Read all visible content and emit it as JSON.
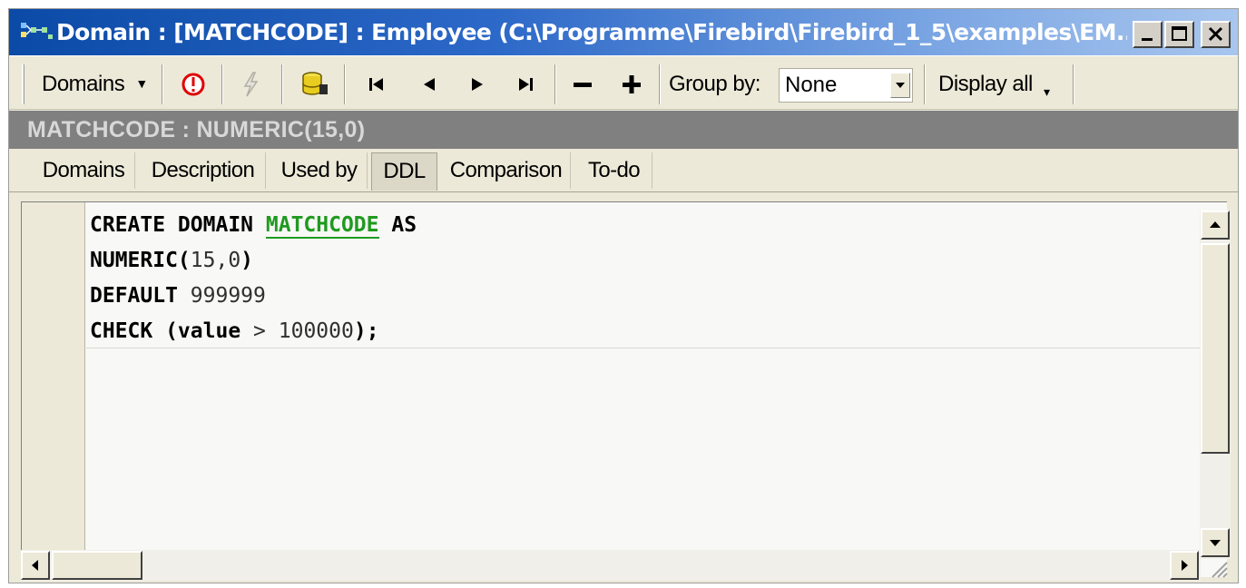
{
  "window": {
    "title": "Domain : [MATCHCODE] : Employee (C:\\Programme\\Firebird\\Firebird_1_5\\examples\\EM..."
  },
  "toolbar": {
    "domains_label": "Domains",
    "group_by_label": "Group by:",
    "group_by_value": "None",
    "display_all_label": "Display all"
  },
  "header": {
    "object_label": "MATCHCODE : NUMERIC(15,0)"
  },
  "tabs": [
    {
      "label": "Domains",
      "active": false
    },
    {
      "label": "Description",
      "active": false
    },
    {
      "label": "Used by",
      "active": false
    },
    {
      "label": "DDL",
      "active": true
    },
    {
      "label": "Comparison",
      "active": false
    },
    {
      "label": "To-do",
      "active": false
    }
  ],
  "code": {
    "line1_kw1": "CREATE DOMAIN",
    "line1_ident": "MATCHCODE",
    "line1_kw2": "AS",
    "line2_kw": "NUMERIC(",
    "line2_val": "15,0",
    "line2_close": ")",
    "line3_kw": "DEFAULT",
    "line3_val": "999999",
    "line4_kw": "CHECK (value",
    "line4_op": ">",
    "line4_val": "100000",
    "line4_end": ");"
  },
  "icons": {
    "app": "tree-icon",
    "stop": "stop-icon",
    "lightning": "lightning-icon",
    "database": "database-icon",
    "first": "first-record-icon",
    "prev": "prev-record-icon",
    "next": "next-record-icon",
    "last": "last-record-icon",
    "delete": "delete-icon",
    "add": "add-icon"
  },
  "colors": {
    "title_bar": "#0b4aa7",
    "identifier": "#1f9a1f",
    "header_bar": "#808080"
  }
}
